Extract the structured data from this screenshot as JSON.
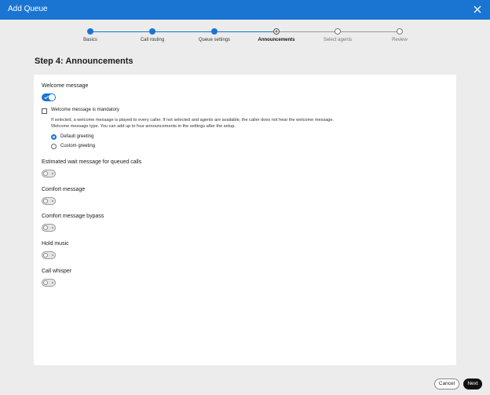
{
  "window": {
    "title": "Add Queue"
  },
  "colors": {
    "primary": "#1a75d2",
    "titlebar": "#1a75d2"
  },
  "icons": {
    "close": "close-icon",
    "check": "check-icon",
    "x": "x-icon"
  },
  "stepper": {
    "steps": [
      {
        "label": "Basics",
        "status": "done"
      },
      {
        "label": "Call routing",
        "status": "done"
      },
      {
        "label": "Queue settings",
        "status": "done"
      },
      {
        "label": "Announcements",
        "status": "current"
      },
      {
        "label": "Select agents",
        "status": "todo"
      },
      {
        "label": "Review",
        "status": "todo"
      }
    ]
  },
  "page": {
    "heading": "Step 4: Announcements"
  },
  "welcome": {
    "label": "Welcome message",
    "enabled": true,
    "mandatory_label": "Welcome message is mandatory",
    "mandatory_checked": false,
    "desc_line1": "If selected, a welcome message is played to every caller. If not selected and agents are available, the caller does not hear the welcome message.",
    "desc_line2": "Welcome message type. You can add up to four announcements in the settings after the setup.",
    "options": [
      {
        "label": "Default greeting",
        "selected": true
      },
      {
        "label": "Custom greeting",
        "selected": false
      }
    ]
  },
  "toggles": [
    {
      "label": "Estimated wait message for queued calls",
      "enabled": false
    },
    {
      "label": "Comfort message",
      "enabled": false
    },
    {
      "label": "Comfort message bypass",
      "enabled": false
    },
    {
      "label": "Hold music",
      "enabled": false
    },
    {
      "label": "Call whisper",
      "enabled": false
    }
  ],
  "footer": {
    "cancel_label": "Cancel",
    "next_label": "Next"
  }
}
